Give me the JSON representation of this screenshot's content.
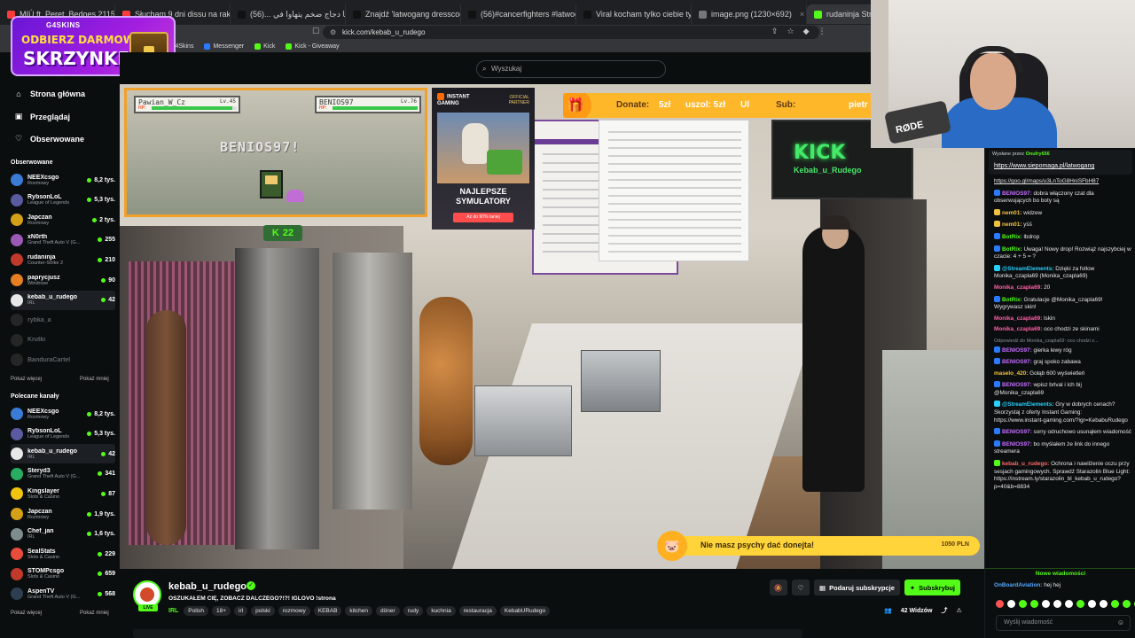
{
  "browser": {
    "tabs": [
      {
        "title": "MIÚ ft. Peret, Bedoes 2115 - fantasia",
        "color": "#ff3b3b"
      },
      {
        "title": "Słucham 9 dni dissu na raka żeby p",
        "color": "#ff3b3b"
      },
      {
        "title": "مسرع شاورما دجاج ضخم يتهاوا في ...(56)",
        "color": "#111111"
      },
      {
        "title": "Znajdź 'latwogang dresscode afera'",
        "color": "#111111"
      },
      {
        "title": "(56)#cancerfighters #latwogang #st",
        "color": "#111111"
      },
      {
        "title": "Viral kocham tylko ciebie ty szmaat",
        "color": "#111111"
      },
      {
        "title": "image.png (1230×692)",
        "color": "#777777"
      },
      {
        "title": "rudaninja Stream - Watch Li",
        "color": "#53fc18"
      }
    ],
    "url": "kick.com/kebab_u_rudego",
    "bookmarks": [
      {
        "label": "G4Skins",
        "color": "#8a2be2"
      },
      {
        "label": "Messenger",
        "color": "#2a7bff"
      },
      {
        "label": "Kick",
        "color": "#53fc18"
      },
      {
        "label": "Kick - Giveaway",
        "color": "#53fc18"
      }
    ]
  },
  "promo": {
    "brand": "G4SKINS",
    "line1": "ODBIERZ DARMOWĄ",
    "line2": "SKRZYNKĘ!"
  },
  "search": {
    "placeholder": "Wyszukaj"
  },
  "sidebar": {
    "nav": [
      {
        "label": "Strona główna",
        "icon": "home-icon"
      },
      {
        "label": "Przeglądaj",
        "icon": "browse-icon"
      },
      {
        "label": "Obserwowane",
        "icon": "heart-icon"
      }
    ],
    "followed_title": "Obserwowane",
    "followed": [
      {
        "name": "NEEXcsgo",
        "category": "Rozmowy",
        "viewers": "8,2 tys.",
        "color": "#3a7bd5",
        "online": true
      },
      {
        "name": "RybsonLoL",
        "category": "League of Legends",
        "viewers": "5,3 tys.",
        "color": "#5a5aa0",
        "online": true
      },
      {
        "name": "Japczan",
        "category": "Rozmowy",
        "viewers": "2 tys.",
        "color": "#d4a017",
        "online": true
      },
      {
        "name": "xN0rth",
        "category": "Grand Theft Auto V (G...",
        "viewers": "255",
        "color": "#9b59b6",
        "online": true
      },
      {
        "name": "rudaninja",
        "category": "Counter-Strike 2",
        "viewers": "210",
        "color": "#c0392b",
        "online": true
      },
      {
        "name": "paprycjusz",
        "category": "Windrose",
        "viewers": "90",
        "color": "#e67e22",
        "online": true
      },
      {
        "name": "kebab_u_rudego",
        "category": "IRL",
        "viewers": "42",
        "color": "#e8e8e8",
        "online": true,
        "selected": true
      },
      {
        "name": "rybka_a",
        "category": "",
        "viewers": "",
        "color": "#555555",
        "online": false
      },
      {
        "name": "Krutki",
        "category": "",
        "viewers": "",
        "color": "#555555",
        "online": false
      },
      {
        "name": "BanduraCartel",
        "category": "",
        "viewers": "",
        "color": "#555555",
        "online": false
      }
    ],
    "show_more": "Pokaż więcej",
    "show_less": "Pokaż mniej",
    "recommended_title": "Polecane kanały",
    "recommended": [
      {
        "name": "NEEXcsgo",
        "category": "Rozmowy",
        "viewers": "8,2 tys.",
        "color": "#3a7bd5"
      },
      {
        "name": "RybsonLoL",
        "category": "League of Legends",
        "viewers": "5,3 tys.",
        "color": "#5a5aa0"
      },
      {
        "name": "kebab_u_rudego",
        "category": "IRL",
        "viewers": "42",
        "color": "#e8e8e8",
        "selected": true
      },
      {
        "name": "Steryd3",
        "category": "Grand Theft Auto V (G...",
        "viewers": "341",
        "color": "#27ae60"
      },
      {
        "name": "Kingslayer",
        "category": "Slots & Casino",
        "viewers": "87",
        "color": "#f1c40f"
      },
      {
        "name": "Japczan",
        "category": "Rozmowy",
        "viewers": "1,9 tys.",
        "color": "#d4a017"
      },
      {
        "name": "Chef_jan",
        "category": "IRL",
        "viewers": "1,6 tys.",
        "color": "#7f8c8d"
      },
      {
        "name": "SealStats",
        "category": "Slots & Casino",
        "viewers": "229",
        "color": "#e74c3c"
      },
      {
        "name": "STOMPcsgo",
        "category": "Slots & Casino",
        "viewers": "659",
        "color": "#c0392b"
      },
      {
        "name": "AspenTV",
        "category": "Grand Theft Auto V (G...",
        "viewers": "568",
        "color": "#2c3e50"
      }
    ]
  },
  "overlay": {
    "player1": {
      "name": "Pawian_W_Cz",
      "level": "Lv.45",
      "hp_label": "HP:",
      "hp_fraction": 0.95
    },
    "player2": {
      "name": "BENIOS97",
      "level": "Lv.76",
      "hp_label": "HP:",
      "hp_fraction": 1.0
    },
    "callout": "BENIOS97!",
    "kick_count": "22",
    "ad": {
      "logo_line1": "INSTANT",
      "logo_line2": "GAMING",
      "partner_line1": "OFFICIAL",
      "partner_line2": "PARTNER",
      "line1": "NAJLEPSZE",
      "line2": "SYMULATORY",
      "cta": "Aż do 90% taniej"
    },
    "donate": {
      "label": "Donate:",
      "seg1": "5zł",
      "seg2": "uszol: 5zł",
      "seg3": "Ul",
      "sub": "Sub:",
      "seg4": "pietr"
    },
    "alert": {
      "message": "Nie masz psychy dać donejta!",
      "amount": "1050 PLN"
    },
    "kick_sign": "KICK",
    "kick_sub": "Kebab_u_Rudego"
  },
  "webcam": {
    "mic_brand": "RØDE"
  },
  "chat": {
    "pinned_by": "Wysłane przez",
    "pinned_user": "Onufry656",
    "pinned_link": "https://www.siepomaga.pl/latwogang",
    "messages": [
      {
        "user": "",
        "text": "https://goo.gl/maps/u3LnToG8HniSFbH87",
        "color": "#e6e6e6",
        "link": true
      },
      {
        "user": "BENIOS97:",
        "text": "dobra włączony czat dla obserwujących bo boty są",
        "color": "#c36bff",
        "badge": "#2a7bff"
      },
      {
        "user": "nem01:",
        "text": "widzew",
        "color": "#f0c040",
        "badge": "#f0c040"
      },
      {
        "user": "nem01:",
        "text": "yśś",
        "color": "#f0c040",
        "badge": "#f0c040"
      },
      {
        "user": "BotRix:",
        "text": "lbdrop",
        "color": "#53fc18",
        "badge": "#2a7bff"
      },
      {
        "user": "BotRix:",
        "text": "Uwaga! Nowy drop! Rozwiąż najszybciej w czacie: 4 + 5 = ?",
        "color": "#53fc18",
        "badge": "#2a7bff"
      },
      {
        "user": "@StreamElements:",
        "text": "Dzięki za follow Monika_czapla69 (Monika_czapla69)",
        "color": "#2bd0ff",
        "badge": "#2bd0ff"
      },
      {
        "user": "Monika_czapla69:",
        "text": "20",
        "color": "#ff5fa8",
        "badge": ""
      },
      {
        "user": "BotRix:",
        "text": "Gratulacje @Monika_czapla69! Wygrywasz skin!",
        "color": "#53fc18",
        "badge": "#2a7bff"
      },
      {
        "user": "Monika_czapla69:",
        "text": "lskin",
        "color": "#ff5fa8",
        "badge": ""
      },
      {
        "user": "Monika_czapla69:",
        "text": "oco chodzi ze skinami",
        "color": "#ff5fa8",
        "badge": ""
      },
      {
        "user": "",
        "text": "Odpowiedź do Monika_czapla69: oco chodzi z...",
        "color": "#8a8f94",
        "reply": true
      },
      {
        "user": "BENIOS97:",
        "text": "gierka lewy róg",
        "color": "#c36bff",
        "badge": "#2a7bff"
      },
      {
        "user": "BENIOS97:",
        "text": "graj spoko zabawa",
        "color": "#c36bff",
        "badge": "#2a7bff"
      },
      {
        "user": "maselo_420:",
        "text": "Gołąb 600 wyświetleń",
        "color": "#f0c040",
        "badge": ""
      },
      {
        "user": "BENIOS97:",
        "text": "wpisz brlval i lch bij @Monika_czapla69",
        "color": "#c36bff",
        "badge": "#2a7bff"
      },
      {
        "user": "@StreamElements:",
        "text": "Gry w dobrych cenach? Skorzystaj z oferty Instant Gaming: https://www.instant-gaming.com/?igr=KebabuRudego",
        "color": "#2bd0ff",
        "badge": "#2bd0ff"
      },
      {
        "user": "BENIOS97:",
        "text": "sorry odruchowo usunąłem wiadomość",
        "color": "#c36bff",
        "badge": "#2a7bff"
      },
      {
        "user": "BENIOS97:",
        "text": "bo myślałem że link do innego streamera",
        "color": "#c36bff",
        "badge": "#2a7bff"
      },
      {
        "user": "kebab_u_rudego:",
        "text": "Ochrona i nawilżenie oczu przy sesjach gamingowych. Sprawdź Starazolin Blue Light: https://instream.ly/starazolin_bl_kebab_u_rudego?p=40&b=8834",
        "color": "#ff6a6a",
        "badge": "#53fc18"
      }
    ],
    "new_messages": "Nowe wiadomości",
    "last_user": "OnBoardAviation:",
    "last_text": "hej hej",
    "input_placeholder": "Wyślij wiadomość"
  },
  "stream": {
    "channel": "kebab_u_rudego",
    "live": "LIVE",
    "title": "OSZUKAŁEM CIĘ, ZOBACZ DALCZEGO?!?! IGLOVO !strona",
    "category": "IRL",
    "tags": [
      "Polish",
      "18+",
      "irl",
      "polski",
      "rozmowy",
      "KEBAB",
      "kitchen",
      "döner",
      "rudy",
      "kuchnia",
      "restauracja",
      "KebabURudego"
    ],
    "gift_sub": "Podaruj subskrypcje",
    "subscribe": "Subskrybuj",
    "viewers": "42 Widzów"
  }
}
